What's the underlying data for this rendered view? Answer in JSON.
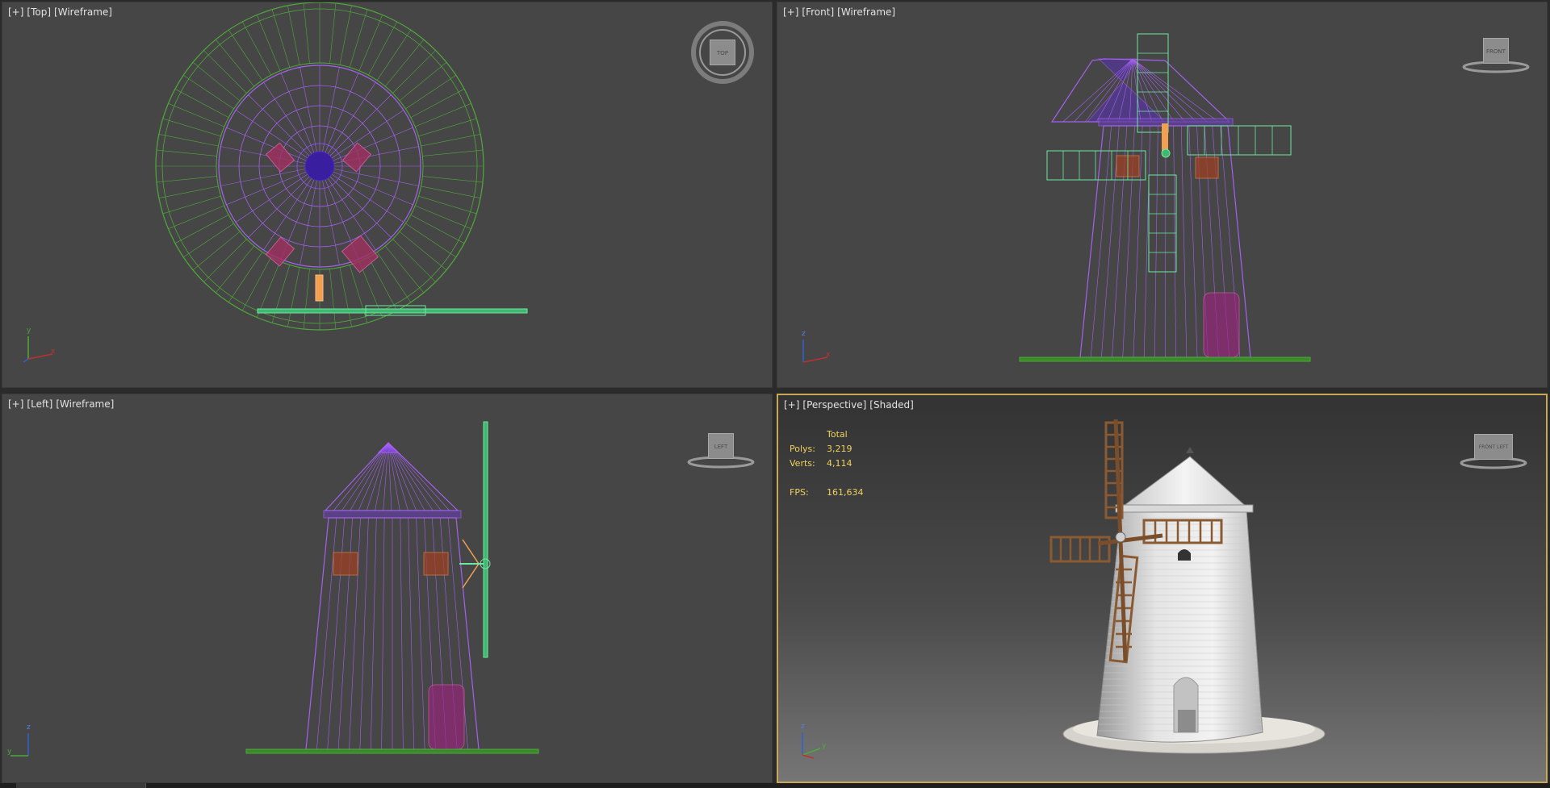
{
  "viewports": {
    "top": {
      "plus": "[+]",
      "view": "[Top]",
      "mode": "[Wireframe]",
      "cube": "TOP"
    },
    "front": {
      "plus": "[+]",
      "view": "[Front]",
      "mode": "[Wireframe]",
      "cube": "FRONT"
    },
    "left": {
      "plus": "[+]",
      "view": "[Left]",
      "mode": "[Wireframe]",
      "cube": "LEFT"
    },
    "persp": {
      "plus": "[+]",
      "view": "[Perspective]",
      "mode": "[Shaded]",
      "cube": "FRONT LEFT"
    }
  },
  "stats": {
    "header": "Total",
    "polys_label": "Polys:",
    "polys": "3,219",
    "verts_label": "Verts:",
    "verts": "4,114",
    "fps_label": "FPS:",
    "fps": "161,634"
  },
  "axes": {
    "top": {
      "v": "y",
      "h": "x"
    },
    "front": {
      "v": "z",
      "h": "x"
    },
    "left": {
      "v": "z",
      "h": "y"
    },
    "persp": {
      "v": "z",
      "h": "y"
    }
  },
  "colors": {
    "viewport_bg": "#464646",
    "active_border": "#c8a854",
    "tower_wire": "#a560f0",
    "ground_wire": "#4fa83a",
    "blade_wire": "#6ee8a0",
    "accent_orange": "#f0a050",
    "stats_text": "#f0d060"
  },
  "icons": [
    "viewcube-icon",
    "axis-tripod-icon"
  ]
}
